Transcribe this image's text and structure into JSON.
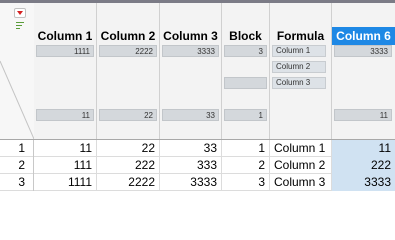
{
  "columns": [
    {
      "name": "Column 1",
      "summary_top": "1111",
      "summary_bottom": "11"
    },
    {
      "name": "Column 2",
      "summary_top": "2222",
      "summary_bottom": "22"
    },
    {
      "name": "Column 3",
      "summary_top": "3333",
      "summary_bottom": "33"
    },
    {
      "name": "Block",
      "summary_top": "3",
      "summary_bottom": "1"
    },
    {
      "name": "Formula",
      "levels": [
        "Column 1",
        "Column 2",
        "Column 3"
      ]
    },
    {
      "name": "Column 6",
      "summary_top": "3333",
      "summary_bottom": "11"
    }
  ],
  "rows": [
    {
      "num": "1",
      "c1": "11",
      "c2": "22",
      "c3": "33",
      "block": "1",
      "formula": "Column 1",
      "c6": "11"
    },
    {
      "num": "2",
      "c1": "111",
      "c2": "222",
      "c3": "333",
      "block": "2",
      "formula": "Column 2",
      "c6": "222"
    },
    {
      "num": "3",
      "c1": "1111",
      "c2": "2222",
      "c3": "3333",
      "block": "3",
      "formula": "Column 3",
      "c6": "3333"
    }
  ],
  "colors": {
    "selected_header": "#1e88e5",
    "selected_cell": "#d0e2f2",
    "menu_triangle": "#d42020"
  },
  "icons": {
    "menu": "red-triangle-menu-icon",
    "filter": "filter-icon"
  }
}
